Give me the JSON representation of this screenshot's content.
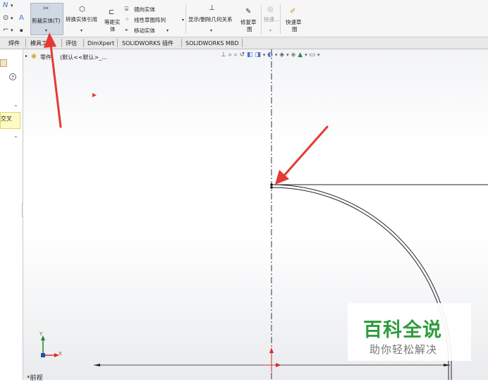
{
  "ribbon": {
    "trim_entities": "剪裁实体(T)",
    "convert_entities": "转换实体引用",
    "offset_entities_line1": "等距实",
    "offset_entities_line2": "体",
    "mirror_entities": "镜向实体",
    "linear_pattern": "线性草图阵列",
    "move_entities": "移动实体",
    "display_delete_relations": "显示/删除几何关系",
    "repair_sketch_line1": "修复草",
    "repair_sketch_line2": "图",
    "quick_snaps": "快速...",
    "rapid_sketch_line1": "快速草",
    "rapid_sketch_line2": "图"
  },
  "tabs": [
    {
      "label": "焊件"
    },
    {
      "label": "模具工具"
    },
    {
      "label": "评估"
    },
    {
      "label": "DimXpert"
    },
    {
      "label": "SOLIDWORKS 插件"
    },
    {
      "label": "SOLIDWORKS MBD"
    }
  ],
  "left_panel": {
    "help": "?",
    "intersect_label": "交叉"
  },
  "tree": {
    "part_label": "零件",
    "config_label": "(默认<<默认>_..."
  },
  "view": {
    "name": "*前视",
    "triad_x": "X",
    "triad_y": "Y"
  },
  "watermark": {
    "title": "百科全说",
    "subtitle": "助你轻松解决"
  },
  "colors": {
    "annotation_arrow": "#e53935",
    "watermark_green": "#2e9c3c",
    "active_button": "#cfd8e3"
  }
}
